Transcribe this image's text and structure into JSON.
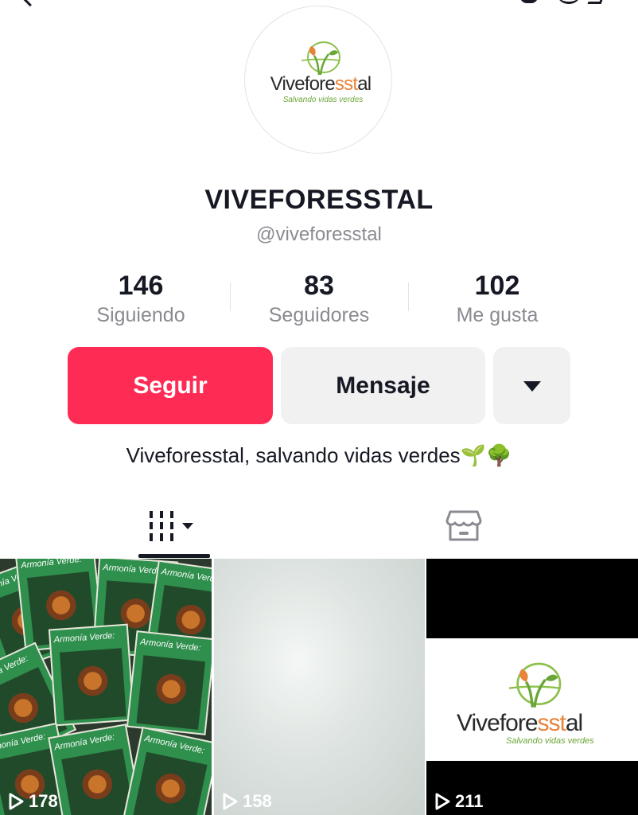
{
  "profile": {
    "avatar_logo": {
      "word_main": "Vivefore",
      "word_accent": "sst",
      "word_end": "al",
      "tagline": "Salvando vidas verdes"
    },
    "display_name": "VIVEFORESSTAL",
    "username": "@viveforesstal",
    "bio": "Viveforesstal, salvando vidas verdes🌱🌳"
  },
  "stats": [
    {
      "value": "146",
      "label": "Siguiendo"
    },
    {
      "value": "83",
      "label": "Seguidores"
    },
    {
      "value": "102",
      "label": "Me gusta"
    }
  ],
  "actions": {
    "follow_label": "Seguir",
    "message_label": "Mensaje",
    "more_icon": "caret-down-icon"
  },
  "tabs": [
    {
      "icon": "videos-grid-icon",
      "selected": true
    },
    {
      "icon": "shop-icon",
      "selected": false
    }
  ],
  "videos": [
    {
      "thumbnail": "book covers Armonía Verde",
      "book_title": "Armonía Verde:",
      "views": "178"
    },
    {
      "thumbnail": "blurred light background",
      "views": "158"
    },
    {
      "thumbnail": "Viveforesstal logo",
      "logo_main": "Vivefore",
      "logo_accent": "sst",
      "logo_end": "al",
      "logo_tagline": "Salvando vidas verdes",
      "views": "211"
    }
  ],
  "colors": {
    "accent": "#fe2c55",
    "secondary_button": "#f1f1f2",
    "muted_text": "#8a8b91",
    "brand_green": "#6aa637",
    "brand_orange": "#e8833a"
  }
}
